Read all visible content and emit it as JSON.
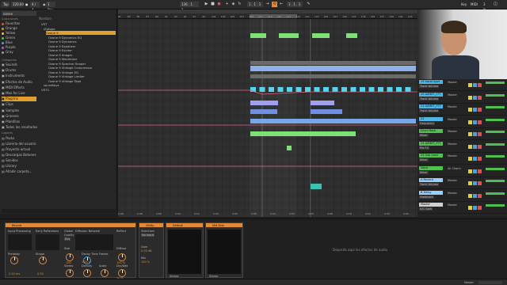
{
  "transport": {
    "tap": "Tap",
    "tempo": "120.00",
    "meter": "4 / 4",
    "quantize": "1 Bar",
    "position": "136 . 1 . 1",
    "punch": "1 . 1 . 1",
    "key": "Key",
    "midi": "MIDI",
    "cpu": "3 %"
  },
  "browser": {
    "search_value": "ozone",
    "collections_header": "Colecciones",
    "collections": [
      {
        "label": "Favoritas",
        "color": "#e05050"
      },
      {
        "label": "Orange",
        "color": "#e08a3a"
      },
      {
        "label": "Yellow",
        "color": "#e0d040"
      },
      {
        "label": "Green",
        "color": "#4fc04f"
      },
      {
        "label": "Blue",
        "color": "#4aa0e0"
      },
      {
        "label": "Purple",
        "color": "#b060d0"
      },
      {
        "label": "Gray",
        "color": "#9a9a9a"
      }
    ],
    "categories_header": "Categorías",
    "categories": [
      "Sounds",
      "Drums",
      "Instruments",
      "Efectos de Audio",
      "MIDI Effects",
      "Max for Live",
      "Plug-Ins",
      "Clips",
      "Samples",
      "Grooves",
      "Plantillas",
      "Todos los resultados"
    ],
    "places_header": "Lugares",
    "places": [
      "Packs",
      "Librería del usuario",
      "Proyecto actual",
      "Descargas Botones",
      "Sonidos",
      "Library",
      "Añadir carpeta..."
    ],
    "name_header": "Nombre",
    "files": [
      "VST",
      "iZotope",
      "Ozone 9",
      "Ozone 9 Dynamics EQ",
      "Ozone 9 Dynamics",
      "Ozone 9 Equalizer",
      "Ozone 9 Exciter",
      "Ozone 9 Imager",
      "Ozone 9 Maximizer",
      "Ozone 9 Spectral Shaper",
      "Ozone 9 Vintage Compressor",
      "Ozone 9 Vintage EQ",
      "Ozone 9 Vintage Limiter",
      "Ozone 9 Vintage Tape",
      "soundtoys",
      "VST3"
    ]
  },
  "arrangement": {
    "locators": [
      "Break",
      "Drop"
    ],
    "ruler_marks": [
      "81",
      "83",
      "85",
      "87",
      "89",
      "91",
      "93",
      "95",
      "97",
      "99",
      "101",
      "103",
      "105",
      "107",
      "109",
      "111",
      "113",
      "115",
      "117",
      "119",
      "121",
      "123",
      "125",
      "127",
      "129",
      "131",
      "133",
      "135",
      "137",
      "139",
      "141",
      "143"
    ],
    "bottom_times": [
      "2:40",
      "2:48",
      "2:56",
      "3:04",
      "3:12",
      "3:20",
      "3:28",
      "3:36",
      "3:44",
      "3:52",
      "4:00",
      "4:08",
      "4:16",
      "4:24",
      "4:32",
      "4:40"
    ]
  },
  "mixer": {
    "tracks": [
      {
        "name": "19 Vocal Spot",
        "color": "#4fb5e5",
        "param": "Track Volume",
        "route": "Master"
      },
      {
        "name": "20 AZMET_FTT",
        "color": "#4fb5e5",
        "param": "Track Volume",
        "route": "Master"
      },
      {
        "name": "21 AZMET_FTT",
        "color": "#4fb5e5",
        "param": "Track Volume",
        "route": "Master"
      },
      {
        "name": "22",
        "color": "#4fb5e5",
        "param": "Frequency",
        "route": "Master"
      },
      {
        "name": "Drum Rack",
        "color": "#52c052",
        "param": "Mixer",
        "route": "Master"
      },
      {
        "name": "24 AZMET_FTT",
        "color": "#52c052",
        "param": "Pre FX",
        "route": "Master"
      },
      {
        "name": "25 Sub Lead",
        "color": "#52c052",
        "param": "Mixer",
        "route": "Master"
      },
      {
        "name": "Voice",
        "color": "#52c052",
        "param": "Mixer",
        "route": "All Chann"
      },
      {
        "name": "A Reverb",
        "color": "#9ad0ff",
        "param": "Track Volume",
        "route": "Master"
      },
      {
        "name": "B Delay",
        "color": "#9ad0ff",
        "param": "Feedback",
        "route": "Master"
      },
      {
        "name": "Master",
        "color": "#d0d0d0",
        "param": "S/C Gain",
        "route": "Master"
      }
    ]
  },
  "devices": {
    "reverb": {
      "title": "Reverb",
      "input_processing": "Input Processing",
      "early_reflections": "Early Reflections",
      "global": "Global",
      "diffusion_network": "Diffusion Network",
      "reflect": "Reflect",
      "quality": "Quality",
      "quality_value": "Eco",
      "size": "Size",
      "decay_time": "Decay Time",
      "freeze": "Freeze",
      "diffuse": "Diffuse",
      "dry_wet": "Dry/Wet",
      "predelay": "Predelay",
      "shape": "Shape",
      "stereo": "Stereo",
      "density": "Density",
      "scale": "Scale",
      "values": [
        "2.50 ms",
        "0.50",
        "100",
        "1.20 s",
        "100 %",
        "100 %",
        "60 %",
        "100 %",
        "30 %"
      ]
    },
    "utility": {
      "title": "Utility",
      "sidechain": "Sidechain",
      "no_input": "No Input",
      "gain": "Gain",
      "gain_value": "0.00 dB",
      "mix": "Mix",
      "mix_value": "100 %"
    },
    "eq_default": {
      "title": "Default",
      "mode": "Stereo"
    },
    "mid_side": {
      "title": "Mid Side",
      "mode": "Stereo"
    },
    "drop_hint": "Deposita aquí los efectos de audio"
  },
  "status": {
    "track": "Master",
    "cpu_icon": "cpu-meter-icon"
  }
}
